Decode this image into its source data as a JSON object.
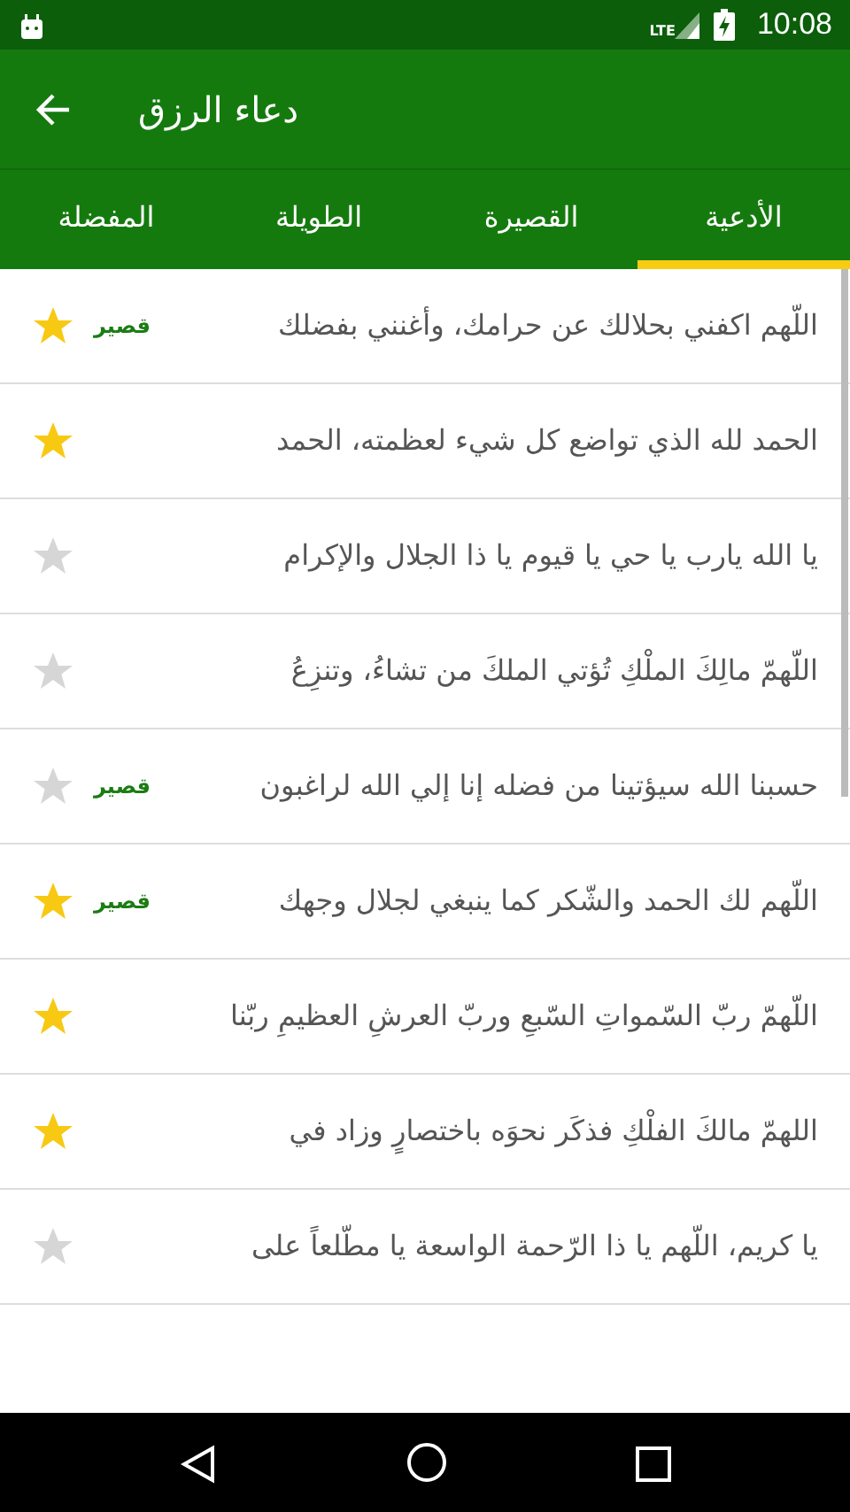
{
  "status_bar": {
    "network": "LTE",
    "time": "10:08"
  },
  "app_bar": {
    "title": "دعاء الرزق"
  },
  "tabs": [
    {
      "label": "الأدعية",
      "selected": true
    },
    {
      "label": "القصيرة",
      "selected": false
    },
    {
      "label": "الطويلة",
      "selected": false
    },
    {
      "label": "المفضلة",
      "selected": false
    }
  ],
  "items": [
    {
      "text": "اللّهم اكفني بحلالك عن حرامك، وأغنني بفضلك",
      "badge": "قصير",
      "favorite": true
    },
    {
      "text": "الحمد لله الذي تواضع كل شيء لعظمته، الحمد",
      "favorite": true
    },
    {
      "text": "يا الله  يارب يا حي يا قيوم يا ذا الجلال  والإكرام",
      "favorite": false
    },
    {
      "text": "اللّهمّ مالِكَ الملْكِ تُؤتي الملكَ من تشاءُ، وتنزِعُ",
      "favorite": false
    },
    {
      "text": "حسبنا الله سيؤتينا من فضله إنا إلي الله لراغبون",
      "badge": "قصير",
      "favorite": false
    },
    {
      "text": "اللّهم لك الحمد والشّكر كما ينبغي لجلال وجهك",
      "badge": "قصير",
      "favorite": true
    },
    {
      "text": "اللّهمّ ربّ السّمواتِ السّبعِ وربّ العرشِ العظيمِ ربّنا",
      "favorite": true
    },
    {
      "text": "اللهمّ مالكَ الفلْكِ فذكَر نحوَه باختصارٍ وزاد في",
      "favorite": true
    },
    {
      "text": "يا كريم، اللّهم يا ذا الرّحمة الواسعة يا مطّلعاً على",
      "favorite": false
    }
  ]
}
